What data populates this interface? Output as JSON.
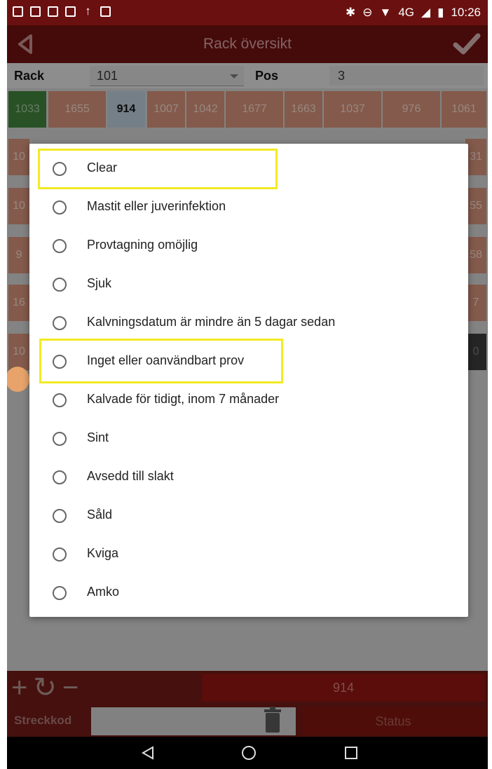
{
  "status_bar": {
    "time": "10:26",
    "network": "4G"
  },
  "app_bar": {
    "title": "Rack översikt"
  },
  "rack_row": {
    "rack_label": "Rack",
    "rack_value": "101",
    "pos_label": "Pos",
    "pos_value": "3"
  },
  "grid_row1": [
    "1033",
    "1655",
    "914",
    "1007",
    "1042",
    "1677",
    "1663",
    "1037",
    "976",
    "1061"
  ],
  "grid_partial_right": [
    "31",
    "55",
    "58",
    "7",
    "0"
  ],
  "grid_partial_left": [
    "10",
    "10",
    "9",
    "16",
    "10"
  ],
  "dialog": {
    "options": [
      "Clear",
      "Mastit eller juverinfektion",
      "Provtagning omöjlig",
      "Sjuk",
      "Kalvningsdatum är mindre än 5 dagar sedan",
      "Inget eller oanvändbart prov",
      "Kalvade för tidigt, inom 7 månader",
      "Sint",
      "Avsedd till slakt",
      "Såld",
      "Kviga",
      "Amko"
    ]
  },
  "bottom_bar": {
    "selected_value": "914",
    "barcode_label": "Streckkod",
    "status_label": "Status"
  },
  "colors": {
    "accent": "#6b1010",
    "highlight": "#f2ea25",
    "cell": "#c98a73"
  }
}
